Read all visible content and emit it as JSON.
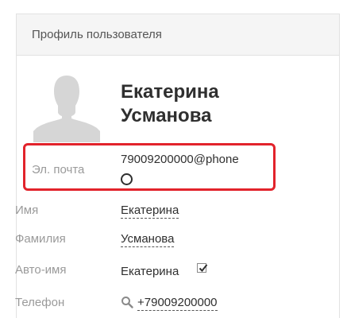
{
  "panel": {
    "title": "Профиль пользователя"
  },
  "profile": {
    "first_name_display": "Екатерина",
    "last_name_display": "Усманова",
    "avatar_icon": "user-avatar-placeholder-icon"
  },
  "fields": {
    "email": {
      "label": "Эл. почта",
      "value": "79009200000@phone",
      "status_icon": "circle-status-icon"
    },
    "first_name": {
      "label": "Имя",
      "value": "Екатерина"
    },
    "last_name": {
      "label": "Фамилия",
      "value": "Усманова"
    },
    "auto_name": {
      "label": "Авто-имя",
      "value": "Екатерина",
      "checked": true
    },
    "phone": {
      "label": "Телефон",
      "value": "+79009200000",
      "icon": "search-icon"
    }
  },
  "colors": {
    "highlight": "#e2232b",
    "header_bg": "#f5f5f5",
    "label": "#9a9a9a",
    "text": "#2f2f2f",
    "checkmark": "#c9a227"
  }
}
